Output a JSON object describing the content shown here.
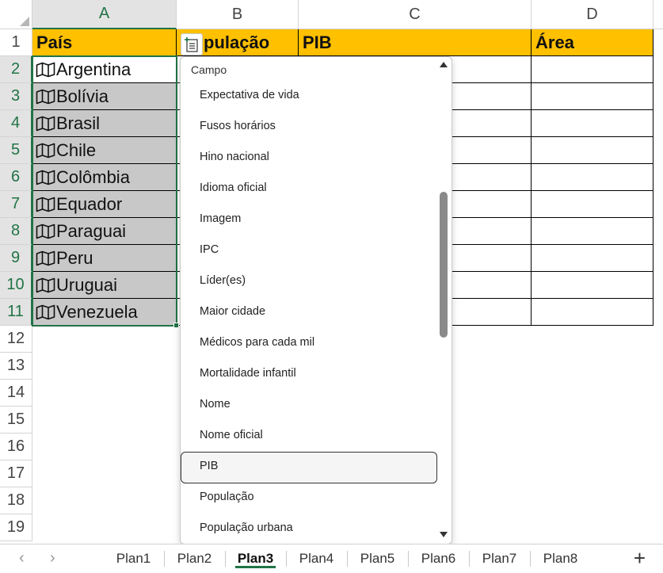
{
  "columns": [
    "A",
    "B",
    "C",
    "D"
  ],
  "rows": [
    "1",
    "2",
    "3",
    "4",
    "5",
    "6",
    "7",
    "8",
    "9",
    "10",
    "11",
    "12",
    "13",
    "14",
    "15",
    "16",
    "17",
    "18",
    "19"
  ],
  "header_row": {
    "a": "País",
    "b": "População",
    "b_visible": "pulação",
    "c": "PIB",
    "d": "Área"
  },
  "countries": [
    "Argentina",
    "Bolívia",
    "Brasil",
    "Chile",
    "Colômbia",
    "Equador",
    "Paraguai",
    "Peru",
    "Uruguai",
    "Venezuela"
  ],
  "dropdown": {
    "header": "Campo",
    "items": [
      "Expectativa de vida",
      "Fusos horários",
      "Hino nacional",
      "Idioma oficial",
      "Imagem",
      "IPC",
      "Líder(es)",
      "Maior cidade",
      "Médicos para cada mil",
      "Mortalidade infantil",
      "Nome",
      "Nome oficial"
    ],
    "selected": "PIB",
    "items_after": [
      "População",
      "População urbana"
    ]
  },
  "tabs": [
    "Plan1",
    "Plan2",
    "Plan3",
    "Plan4",
    "Plan5",
    "Plan6",
    "Plan7",
    "Plan8"
  ],
  "active_tab": "Plan3",
  "tabbar": {
    "prev": "‹",
    "next": "›",
    "add": "+"
  },
  "icons": [
    "map-icon",
    "insert-data-icon",
    "scroll-up-icon",
    "scroll-down-icon"
  ],
  "colors": {
    "header_fill": "#ffc000",
    "selection": "#217346",
    "selected_fill": "#c8c8c8"
  }
}
